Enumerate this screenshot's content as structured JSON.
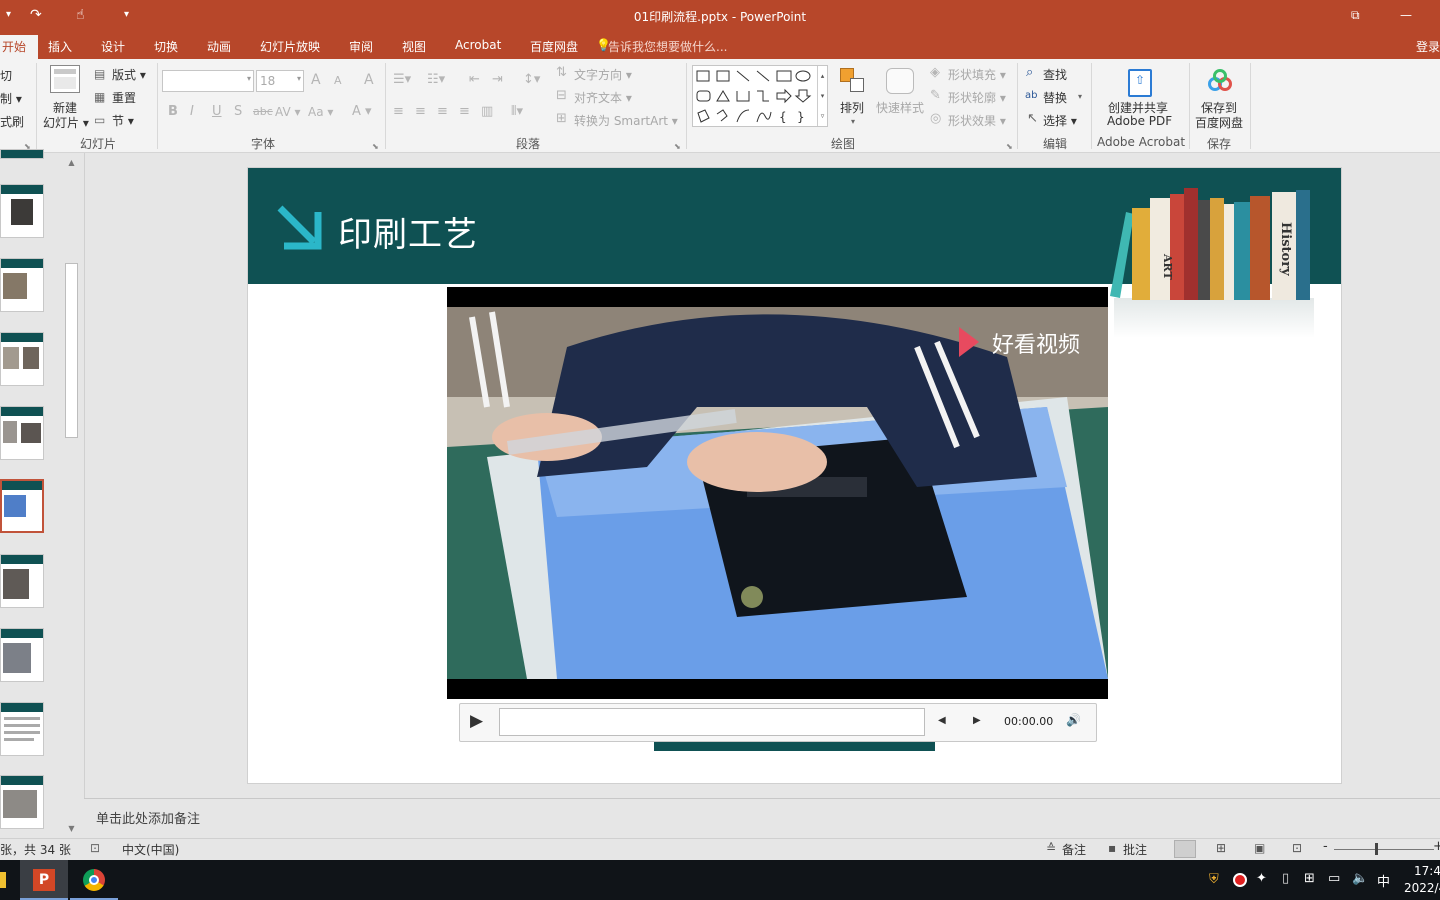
{
  "window": {
    "title": "01印刷流程.pptx - PowerPoint",
    "accent": "#b7472a",
    "controls": {
      "restore": "⧉",
      "minimize": "—"
    }
  },
  "quick_access": {
    "dropdown": "▾",
    "redo": "↷",
    "touch": "☝",
    "customize": "▾"
  },
  "tabs": [
    {
      "label": "开始",
      "active": true
    },
    {
      "label": "插入"
    },
    {
      "label": "设计"
    },
    {
      "label": "切换"
    },
    {
      "label": "动画"
    },
    {
      "label": "幻灯片放映"
    },
    {
      "label": "审阅"
    },
    {
      "label": "视图"
    },
    {
      "label": "Acrobat"
    },
    {
      "label": "百度网盘"
    }
  ],
  "tell_me": "告诉我您想要做什么...",
  "sign_in": "登录",
  "ribbon": {
    "clipboard": {
      "cut": "切",
      "copy": "制 ▾",
      "painter": "式刷"
    },
    "slides": {
      "label": "幻灯片",
      "new_slide": "新建",
      "new_slide2": "幻灯片 ▾",
      "layout": "版式 ▾",
      "reset": "重置",
      "section": "节 ▾"
    },
    "font": {
      "label": "字体",
      "font_name": "",
      "font_size": "18",
      "grow": "A",
      "shrink": "A",
      "clear": "A",
      "bold": "B",
      "italic": "I",
      "underline": "U",
      "shadow": "S",
      "strike": "abc",
      "spacing": "AV ▾",
      "case": "Aa ▾",
      "color": "A ▾"
    },
    "paragraph": {
      "label": "段落",
      "text_direction": "文字方向 ▾",
      "align_text": "对齐文本 ▾",
      "smartart": "转换为 SmartArt ▾"
    },
    "drawing": {
      "label": "绘图",
      "arrange": "排列",
      "quick_styles": "快速样式",
      "fill": "形状填充 ▾",
      "outline": "形状轮廓 ▾",
      "effects": "形状效果 ▾"
    },
    "editing": {
      "label": "编辑",
      "find": "查找",
      "replace": "替换",
      "select": "选择 ▾"
    },
    "acrobat": {
      "label": "Adobe Acrobat",
      "btn1": "创建并共享",
      "btn2": "Adobe PDF"
    },
    "save": {
      "label": "保存",
      "btn1": "保存到",
      "btn2": "百度网盘"
    }
  },
  "slide": {
    "title": "印刷工艺",
    "book_label_1": "ART",
    "book_label_2": "History",
    "header_color": "#0f5153"
  },
  "video": {
    "watermark": "好看视频",
    "time": "00:00.00",
    "play": "▶",
    "back": "◀",
    "forward": "▶",
    "volume": "🔊"
  },
  "notes": {
    "placeholder": "单击此处添加备注"
  },
  "status": {
    "slide_count": "张，共 34 张",
    "language": "中文(中国)",
    "notes": "备注",
    "comments": "批注",
    "zoom_minus": "-",
    "zoom_plus": "+"
  },
  "taskbar": {
    "time": "17:4",
    "date": "2022/4",
    "ime": "中"
  }
}
